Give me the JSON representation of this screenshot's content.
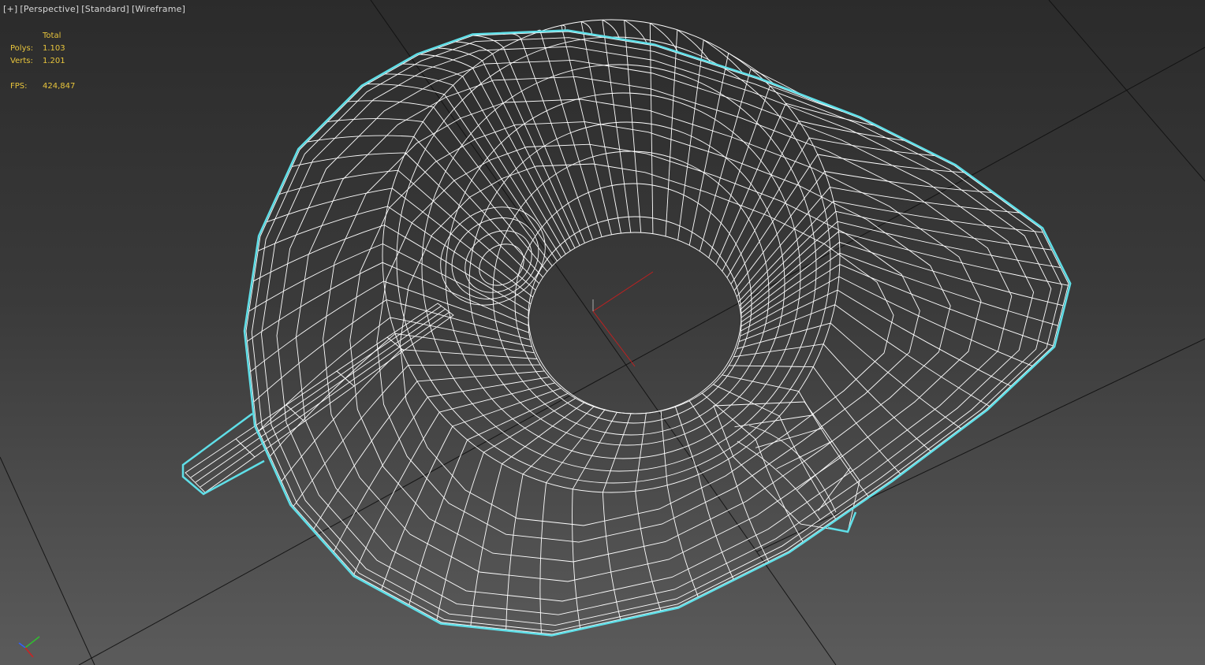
{
  "viewport": {
    "labels": {
      "plus": "[+]",
      "view": "[Perspective]",
      "shading_mode": "[Standard]",
      "display_mode": "[Wireframe]"
    },
    "stats": {
      "header": "Total",
      "polys_label": "Polys:",
      "polys_value": "1.103",
      "verts_label": "Verts:",
      "verts_value": "1.201",
      "fps_label": "FPS:",
      "fps_value": "424,847"
    },
    "colors": {
      "background_top": "#2b2b2b",
      "background_bottom": "#5b5b5b",
      "wire": "#ffffff",
      "selection_outline": "#5fdfe8",
      "stats_text": "#e8c53c",
      "grid": "#101010",
      "axis_x": "#c02020",
      "axis_y": "#20c020",
      "axis_z": "#3050ff"
    },
    "object": {
      "description_icon": "wireframe-saucer-cup-spoon",
      "selected": true
    }
  }
}
